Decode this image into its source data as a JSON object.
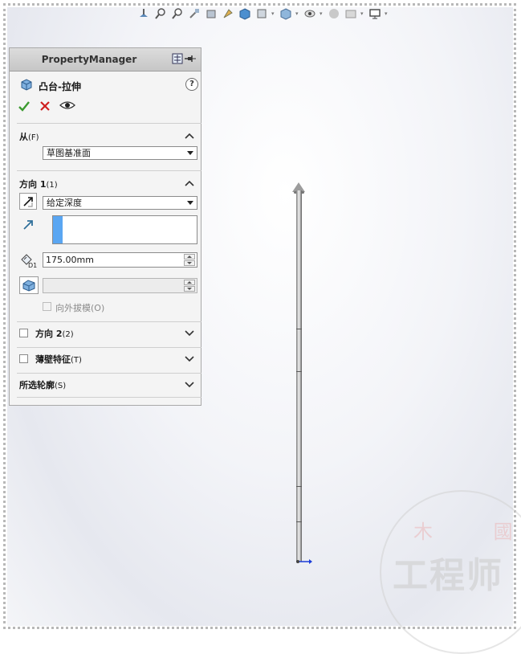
{
  "property_manager": {
    "title": "PropertyManager",
    "feature_title": "凸台-拉伸",
    "help": "?"
  },
  "sections": {
    "from": {
      "label": "从",
      "accel": "(F)",
      "value": "草图基准面"
    },
    "direction1": {
      "label": "方向 1",
      "accel": "(1)",
      "end_condition": "给定深度",
      "depth": "175.00mm",
      "draft_label": "向外拔模(O)"
    },
    "direction2": {
      "label": "方向 2",
      "accel": "(2)"
    },
    "thin_feature": {
      "label": "薄壁特征",
      "accel": "(T)"
    },
    "selected_contours": {
      "label": "所选轮廓",
      "accel": "(S)"
    }
  },
  "depth_icon_text": "D1",
  "watermark": {
    "top": "木 國",
    "bottom": "工程师"
  },
  "colors": {
    "confirm": "#3b9a2f",
    "cancel": "#cf2020",
    "selection": "#5aa6f2"
  }
}
